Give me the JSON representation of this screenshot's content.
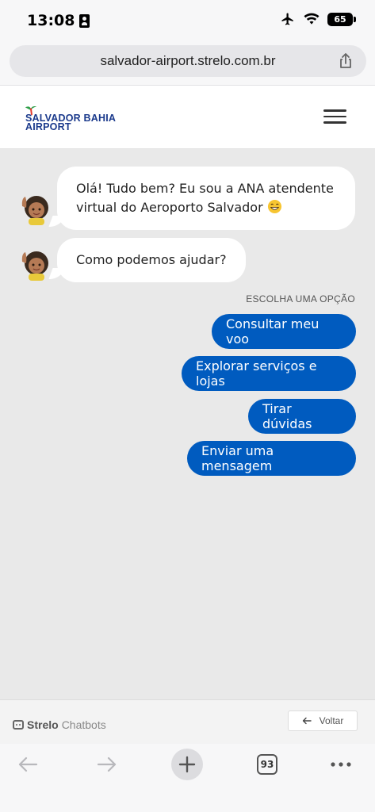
{
  "status_bar": {
    "time": "13:08",
    "battery": "65"
  },
  "browser": {
    "url": "salvador-airport.strelo.com.br",
    "tabs_count": "93"
  },
  "site": {
    "logo_line1": "SALVADOR BAHIA",
    "logo_line2": "AIRPORT"
  },
  "chat": {
    "messages": [
      {
        "text": "Olá! Tudo bem? Eu sou a ANA atendente virtual do Aeroporto Salvador"
      },
      {
        "text": "Como podemos ajudar?"
      }
    ],
    "choose_label": "ESCOLHA UMA OPÇÃO",
    "options": [
      "Consultar meu voo",
      "Explorar serviços e lojas",
      "Tirar dúvidas",
      "Enviar uma mensagem"
    ]
  },
  "footer": {
    "brand_name": "Strelo",
    "brand_sub": "Chatbots",
    "back_label": "Voltar"
  },
  "colors": {
    "accent": "#005bbf",
    "chat_bg": "#e9e9e9",
    "logo_blue": "#1b3a8c"
  }
}
